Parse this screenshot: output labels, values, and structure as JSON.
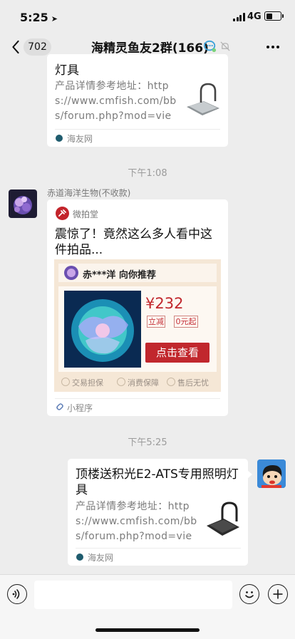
{
  "status_bar": {
    "time": "5:25",
    "network": "4G",
    "battery_level": 0.4
  },
  "nav": {
    "back_count": "702",
    "title": "海精灵鱼友2群(166)"
  },
  "messages": {
    "top_card": {
      "title_tail": "灯具",
      "desc": "产品详情参考地址：https://www.cmfish.com/bbs/forum.php?mod=viewthr...",
      "source": "海友网"
    },
    "ts1": "下午1:08",
    "sender_name": "赤道海洋生物(不收款)",
    "mini_program": {
      "brand": "微拍堂",
      "headline": "震惊了！竟然这么多人看中这件拍品...",
      "recommender": "赤***洋 向你推荐",
      "price": "¥232",
      "tag_instant": "立减",
      "tag_start": "0元起",
      "cta": "点击查看",
      "features": [
        "交易担保",
        "消费保障",
        "售后无忧"
      ],
      "footer": "小程序"
    },
    "ts2": "下午5:25",
    "my_card": {
      "title": "顶楼送积光E2-ATS专用照明灯具",
      "desc": "产品详情参考地址：https://www.cmfish.com/bbs/forum.php?mod=viewthr...",
      "source": "海友网"
    }
  }
}
